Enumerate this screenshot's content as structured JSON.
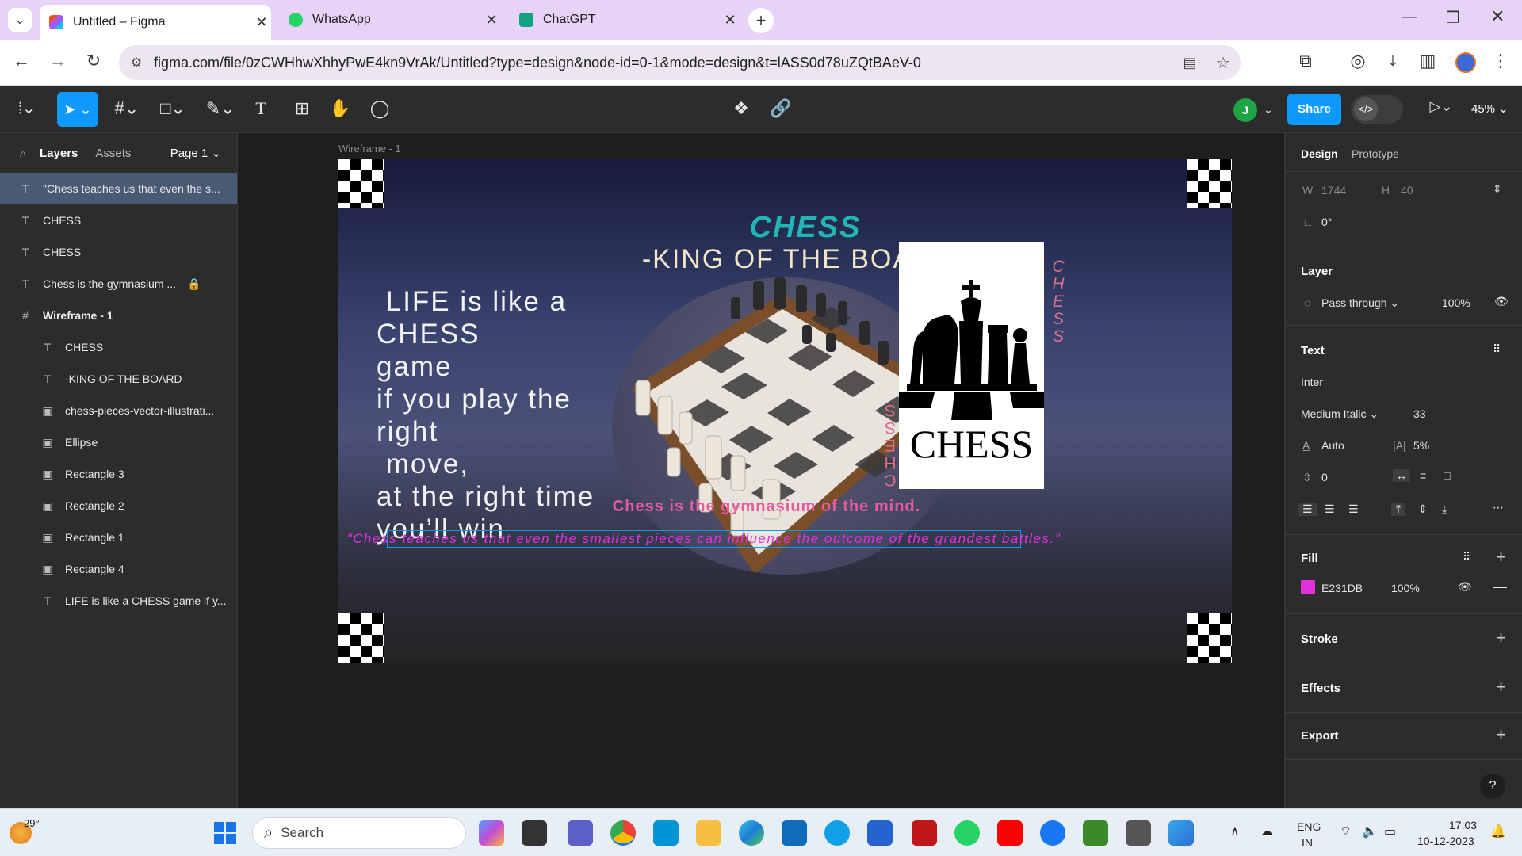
{
  "browser": {
    "tabs": [
      {
        "title": "Untitled – Figma"
      },
      {
        "title": "WhatsApp"
      },
      {
        "title": "ChatGPT"
      }
    ],
    "url": "figma.com/file/0zCWHhwXhhyPwE4kn9VrAk/Untitled?type=design&node-id=0-1&mode=design&t=lASS0d78uZQtBAeV-0"
  },
  "toolbar": {
    "share_label": "Share",
    "avatar_initial": "J",
    "zoom": "45%"
  },
  "left_panel": {
    "tab_layers": "Layers",
    "tab_assets": "Assets",
    "page": "Page 1",
    "layers": [
      {
        "name": "\"Chess teaches us that even the s...",
        "icon": "text-icon",
        "indent": 0,
        "selected": true
      },
      {
        "name": "CHESS",
        "icon": "text-icon",
        "indent": 0
      },
      {
        "name": "CHESS",
        "icon": "text-icon",
        "indent": 0
      },
      {
        "name": "Chess is the gymnasium ...",
        "icon": "text-icon",
        "indent": 0,
        "locked": true
      },
      {
        "name": "Wireframe - 1",
        "icon": "frame-icon",
        "indent": 0,
        "bold": true
      },
      {
        "name": "CHESS",
        "icon": "text-icon",
        "indent": 1
      },
      {
        "name": "-KING OF THE BOARD",
        "icon": "text-icon",
        "indent": 1
      },
      {
        "name": "chess-pieces-vector-illustrati...",
        "icon": "image-icon",
        "indent": 1
      },
      {
        "name": "Ellipse",
        "icon": "image-icon",
        "indent": 1
      },
      {
        "name": "Rectangle 3",
        "icon": "image-icon",
        "indent": 1
      },
      {
        "name": "Rectangle 2",
        "icon": "image-icon",
        "indent": 1
      },
      {
        "name": "Rectangle 1",
        "icon": "image-icon",
        "indent": 1
      },
      {
        "name": "Rectangle 4",
        "icon": "image-icon",
        "indent": 1
      },
      {
        "name": "LIFE is like a CHESS game if y...",
        "icon": "text-icon",
        "indent": 1
      }
    ]
  },
  "canvas": {
    "frame_label": "Wireframe - 1",
    "title": "CHESS",
    "subtitle": "-KING OF THE BOARD",
    "life_lines": [
      " LIFE is like a",
      "CHESS",
      "game",
      "if you play the",
      "right",
      " move,",
      "at the right time",
      "you’ll win"
    ],
    "gym_text": "Chess is the gymnasium of the mind.",
    "quote": "\"Chess teaches us that even the smallest pieces can influence the outcome of the grandest battles.\"",
    "logo_text": "CHESS",
    "vertical_text": "CHESS",
    "colors": {
      "title": "#22b5b5",
      "gym": "#e85a9d",
      "quote": "#e231db",
      "vertical": "#d9708f"
    }
  },
  "right_panel": {
    "tab_design": "Design",
    "tab_prototype": "Prototype",
    "w_label": "W",
    "w_value": "1744",
    "h_label": "H",
    "h_value": "40",
    "rotation": "0°",
    "layer_title": "Layer",
    "blend": "Pass through",
    "opacity": "100%",
    "text_title": "Text",
    "font": "Inter",
    "style": "Medium Italic",
    "size": "33",
    "line_height": "Auto",
    "letter_spacing": "5%",
    "paragraph": "0",
    "fill_title": "Fill",
    "fill_hex": "E231DB",
    "fill_opacity": "100%",
    "fill_color": "#e231db",
    "stroke_title": "Stroke",
    "effects_title": "Effects",
    "export_title": "Export",
    "help": "?"
  },
  "taskbar": {
    "temp": "29°",
    "search": "Search",
    "lang1": "ENG",
    "lang2": "IN",
    "time": "17:03",
    "date": "10-12-2023"
  }
}
